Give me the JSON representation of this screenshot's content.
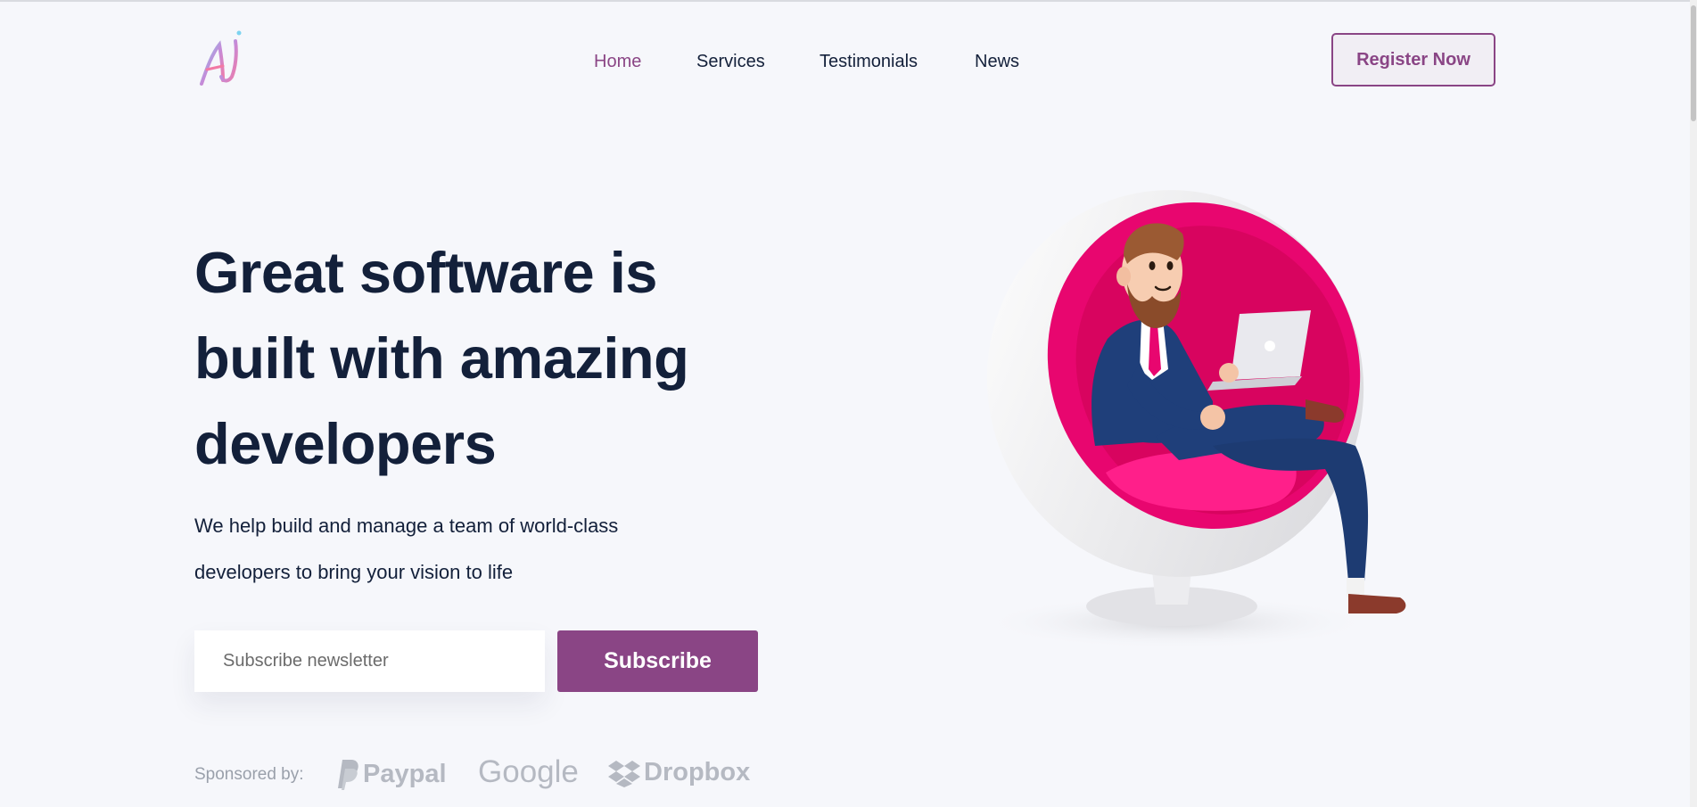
{
  "header": {
    "logo_alt": "AJ",
    "nav": [
      {
        "label": "Home",
        "active": true
      },
      {
        "label": "Services",
        "active": false
      },
      {
        "label": "Testimonials",
        "active": false
      },
      {
        "label": "News",
        "active": false
      }
    ],
    "cta_label": "Register Now"
  },
  "hero": {
    "headline_lines": [
      "Great software is",
      "built with amazing",
      "developers"
    ],
    "subtext_lines": [
      "We help build and manage a team of world-class",
      "developers to bring your vision to life"
    ],
    "newsletter_placeholder": "Subscribe newsletter",
    "subscribe_label": "Subscribe"
  },
  "sponsors": {
    "label": "Sponsored by:",
    "items": [
      "Paypal",
      "Google",
      "Dropbox"
    ]
  },
  "colors": {
    "brand": "#8a4585",
    "text": "#13203a",
    "background": "#f6f7fb",
    "chair_pink": "#e8066f"
  }
}
